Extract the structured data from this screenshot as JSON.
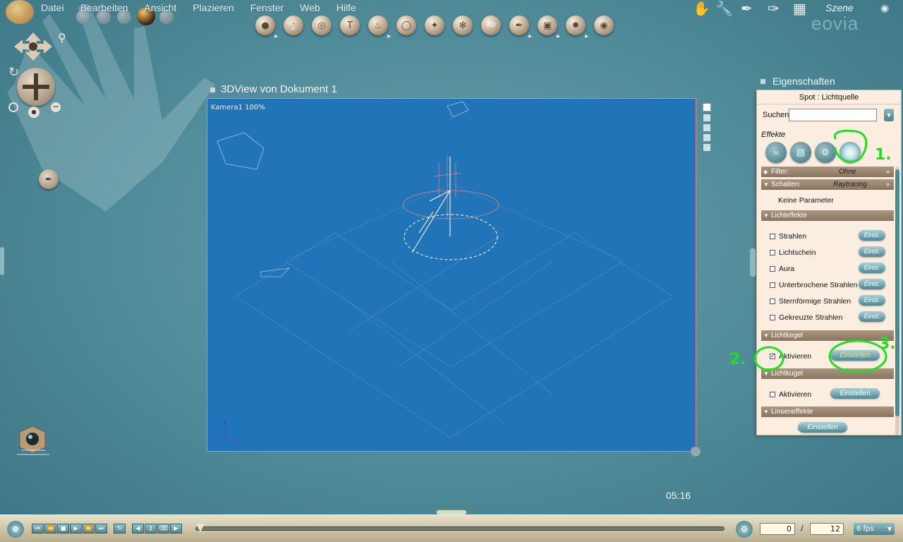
{
  "menu": {
    "items": [
      "Datei",
      "Bearbeiten",
      "Ansicht",
      "Plazieren",
      "Fenster",
      "Web",
      "Hilfe"
    ]
  },
  "toolbar": {
    "icons": [
      "sphere-icon",
      "glass-icon",
      "globe-icon",
      "text-icon",
      "flame-icon",
      "torus-icon",
      "bone-icon",
      "grid-icon",
      "4d-icon",
      "brush-icon",
      "cube-icon",
      "sun-icon",
      "ring-icon"
    ],
    "labels": {
      "4d": "4D",
      "text": "T"
    }
  },
  "scene": {
    "label": "Szene",
    "brand": "eovia"
  },
  "document": {
    "title": "3DView von Dokument 1",
    "camera_label": "Kamera1 100%",
    "axis_z": "z"
  },
  "properties": {
    "title": "Eigenschaften",
    "header": "Spot : Lichtquelle",
    "search_label": "Suchen:",
    "search_value": "",
    "effects_label": "Effekte",
    "filter_label": "Filter:",
    "filter_value": "Ohne",
    "shadow_label": "Schatten:",
    "shadow_value": "Raytracing",
    "no_params": "Keine Parameter",
    "section_light_effects": "Lichteffekte",
    "light_effects": [
      {
        "label": "Strahlen",
        "checked": false,
        "button": "Einst."
      },
      {
        "label": "Lichtschein",
        "checked": false,
        "button": "Einst."
      },
      {
        "label": "Aura",
        "checked": false,
        "button": "Einst."
      },
      {
        "label": "Unterbrochene Strahlen",
        "checked": false,
        "button": "Einst."
      },
      {
        "label": "Sternförmige Strahlen",
        "checked": false,
        "button": "Einst."
      },
      {
        "label": "Gekreuzte Strahlen",
        "checked": false,
        "button": "Einst."
      }
    ],
    "section_cone": "Lichtkegel",
    "cone_activate": "Aktivieren",
    "cone_checked": true,
    "cone_button": "Einstellen",
    "section_sphere": "Lichtkugel",
    "sphere_activate": "Aktivieren",
    "sphere_checked": false,
    "sphere_button": "Einstellen",
    "section_lens": "Linseneffekte",
    "lens_button": "Einstellen"
  },
  "annotations": {
    "a1": "1.",
    "a2": "2.",
    "a3": "3.",
    "color": "#22dd22"
  },
  "timer": "05:16",
  "playback": {
    "current_frame": "0",
    "separator": "/",
    "total_frames": "12",
    "fps": "6 fps"
  },
  "colors": {
    "viewport": "#2174b8",
    "panel": "#fbeee1",
    "background": "#5a93a0"
  }
}
